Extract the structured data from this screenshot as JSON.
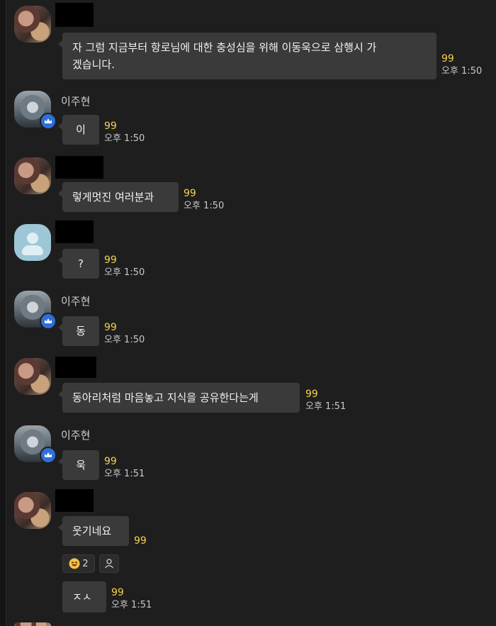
{
  "messages": [
    {
      "sender": "",
      "text_line1": "자 그럼 지금부터 항로님에 대한 충성심을 위해 이동욱으로 삼행시 가",
      "text_line2": "겠습니다.",
      "count": "99",
      "time": "오후 1:50"
    },
    {
      "sender": "이주현",
      "text": "이",
      "count": "99",
      "time": "오후 1:50"
    },
    {
      "sender": "",
      "text": "렇게멋진 여러분과",
      "count": "99",
      "time": "오후 1:50"
    },
    {
      "sender": "",
      "text": "?",
      "count": "99",
      "time": "오후 1:50"
    },
    {
      "sender": "이주현",
      "text": "동",
      "count": "99",
      "time": "오후 1:50"
    },
    {
      "sender": "",
      "text": "동아리처럼 마음놓고 지식을 공유한다는게",
      "count": "99",
      "time": "오후 1:51"
    },
    {
      "sender": "이주현",
      "text": "욱",
      "count": "99",
      "time": "오후 1:51"
    },
    {
      "sender": "",
      "text": "웃기네요",
      "count": "99",
      "reaction_count": "2",
      "text2": "ㅈㅅ",
      "count2": "99",
      "time2": "오후 1:51"
    }
  ],
  "icons": {
    "crown": "crown-icon",
    "default_avatar": "person-icon",
    "reaction_emoji": "laughing-face-emoji",
    "reactor_list": "person-outline-icon"
  },
  "colors": {
    "background": "#1e1e1e",
    "bubble": "#3a3a3a",
    "unread": "#f5d44a",
    "host_badge": "#2f6fd8"
  }
}
